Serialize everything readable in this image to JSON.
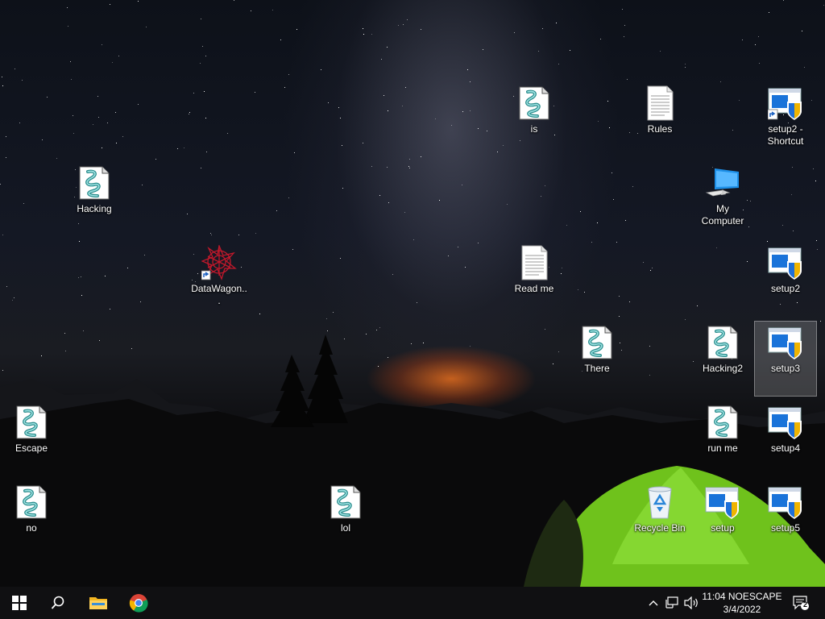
{
  "desktop": {
    "icons": [
      {
        "id": "is",
        "label": "is",
        "type": "script"
      },
      {
        "id": "rules",
        "label": "Rules",
        "type": "text"
      },
      {
        "id": "setup2-shortcut",
        "label": "setup2 - Shortcut",
        "type": "installer-shortcut"
      },
      {
        "id": "hacking",
        "label": "Hacking",
        "type": "script"
      },
      {
        "id": "my-computer",
        "label": "My Computer",
        "type": "computer"
      },
      {
        "id": "datawagon",
        "label": "DataWagon...",
        "type": "app-shortcut"
      },
      {
        "id": "read-me",
        "label": "Read me",
        "type": "text"
      },
      {
        "id": "setup2",
        "label": "setup2",
        "type": "installer"
      },
      {
        "id": "there",
        "label": "There",
        "type": "script"
      },
      {
        "id": "hacking2",
        "label": "Hacking2",
        "type": "script"
      },
      {
        "id": "setup3",
        "label": "setup3",
        "type": "installer",
        "selected": true
      },
      {
        "id": "escape",
        "label": "Escape",
        "type": "script"
      },
      {
        "id": "run-me",
        "label": "run me",
        "type": "script"
      },
      {
        "id": "setup4",
        "label": "setup4",
        "type": "installer"
      },
      {
        "id": "no",
        "label": "no",
        "type": "script"
      },
      {
        "id": "lol",
        "label": "lol",
        "type": "script"
      },
      {
        "id": "recycle-bin",
        "label": "Recycle Bin",
        "type": "recycle-bin"
      },
      {
        "id": "setup",
        "label": "setup",
        "type": "installer"
      },
      {
        "id": "setup5",
        "label": "setup5",
        "type": "installer"
      }
    ]
  },
  "taskbar": {
    "start_icon": "windows-logo-icon",
    "search_icon": "search-icon",
    "pinned": [
      {
        "name": "file-explorer-icon"
      },
      {
        "name": "chrome-icon"
      }
    ],
    "tray": {
      "chevron_icon": "chevron-up-icon",
      "network_icon": "network-icon",
      "volume_icon": "volume-icon",
      "clock_time": "11:04 NOESCAPE",
      "clock_date": "3/4/2022",
      "notification_icon": "action-center-icon",
      "notification_count": "2"
    }
  },
  "colors": {
    "taskbar": "#101012",
    "tent": "#7ed321",
    "horizon_glow": "#ff7a20",
    "selection": "#ffffff"
  }
}
